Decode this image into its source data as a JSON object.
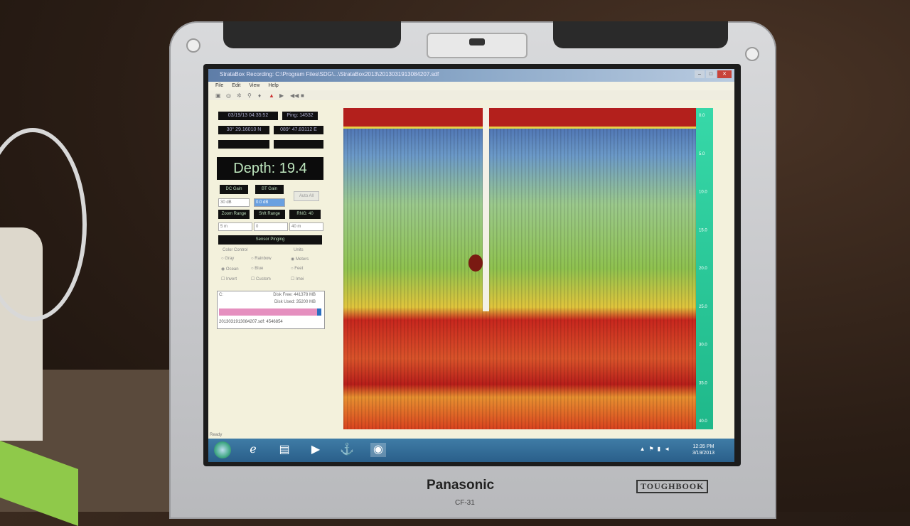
{
  "window": {
    "title": "StrataBox Recording: C:\\Program Files\\SDG\\...\\StrataBox2013\\2013031913084207.sdf",
    "menu": [
      "File",
      "Edit",
      "View",
      "Help"
    ],
    "controls": {
      "minimize": "–",
      "maximize": "□",
      "close": "✕"
    }
  },
  "toolbar_icons": [
    "open-icon",
    "record-icon",
    "settings-icon",
    "pin-icon",
    "marker-icon",
    "warning-icon",
    "play-icon",
    "rewind-icon",
    "stop-icon"
  ],
  "readouts": {
    "datetime": "03/19/13 04:35:52",
    "ping": "Ping: 14532",
    "latitude": "30° 29.16010 N",
    "longitude": "089° 47.83112 E",
    "depth": "Depth: 19.4"
  },
  "controls": {
    "dc_gain_label": "DC Gain",
    "bt_gain_label": "BT Gain",
    "auto_all_label": "Auto All",
    "dc_gain_value": "30 dB",
    "bt_gain_value": "0.0 dB",
    "zoom_range_label": "Zoom Range",
    "shift_range_label": "Shft Range",
    "range_label": "RNG: 40",
    "zoom_value": "5 m",
    "shift_value": "0",
    "range_value": "40 m",
    "sensor_status": "Sensor Pinging"
  },
  "color_control": {
    "title": "Color Control",
    "options": [
      "Gray",
      "Rainbow",
      "Ocean",
      "Blue"
    ],
    "selected": "Ocean",
    "invert": "Invert",
    "custom": "Custom"
  },
  "units": {
    "title": "Units",
    "options": [
      "Meters",
      "Feet"
    ],
    "selected": "Meters",
    "imei": "Imei"
  },
  "disk": {
    "drive": "C:",
    "free": "Disk Free: 441378 MB",
    "used": "Disk Used: 35200 MB",
    "used_fraction": 0.93,
    "file": "2013031913084207.sdf: 4546854"
  },
  "depth_scale": [
    "0.0",
    "5.0",
    "10.0",
    "15.0",
    "20.0",
    "25.0",
    "30.0",
    "35.0",
    "40.0"
  ],
  "status_bar": "Ready",
  "taskbar": {
    "clock_time": "12:35 PM",
    "clock_date": "3/19/2013"
  },
  "hardware": {
    "brand": "Panasonic",
    "model": "CF-31",
    "badge": "TOUGHBOOK"
  }
}
